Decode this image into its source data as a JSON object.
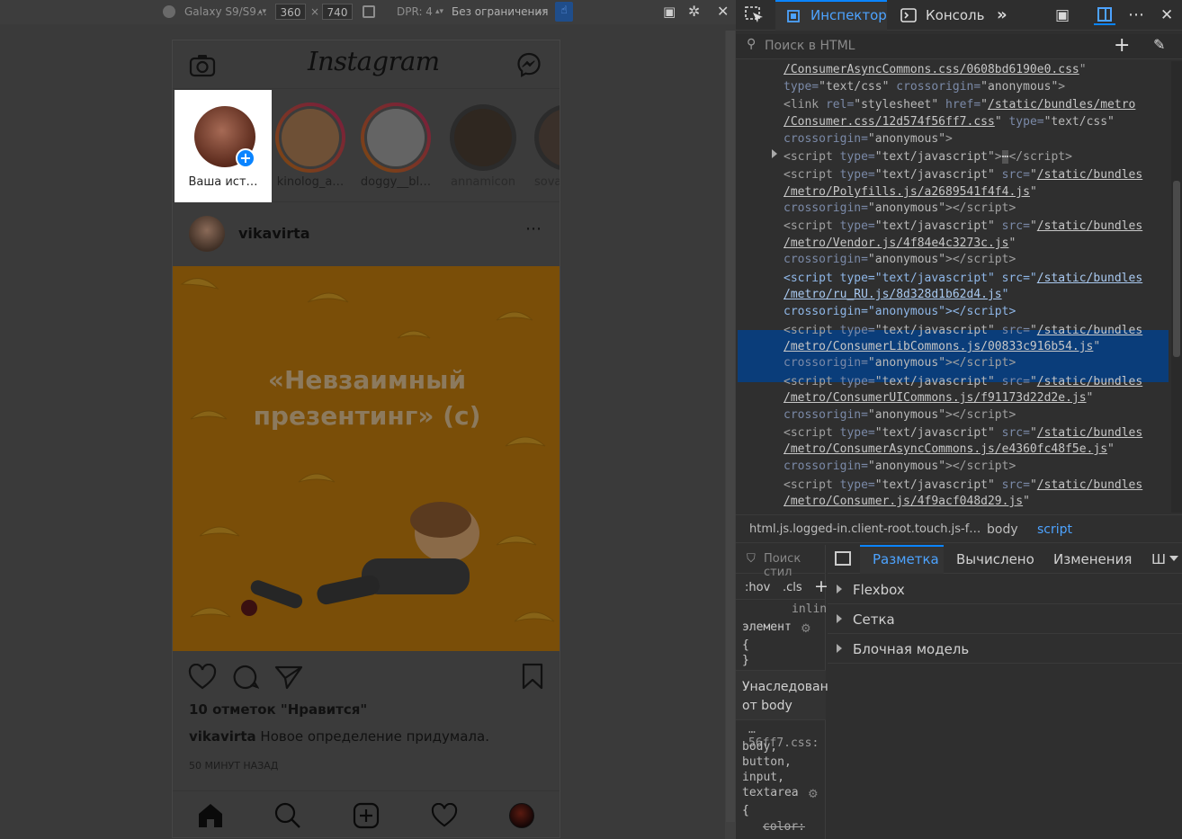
{
  "rdm": {
    "device": "Galaxy S9/S9…",
    "width": "360",
    "times": "×",
    "height": "740",
    "dpr": "DPR: 4",
    "throttle": "Без ограничения"
  },
  "instagram": {
    "logo": "Instagram",
    "stories": [
      {
        "name": "Ваша ист…",
        "own": true,
        "color": "#7a4431"
      },
      {
        "name": "kinolog_a…",
        "own": false,
        "color": "#b88a5a"
      },
      {
        "name": "doggy__bl…",
        "own": false,
        "color": "#a8a8a8"
      },
      {
        "name": "annamicon",
        "own": false,
        "color": "#504030"
      },
      {
        "name": "sova",
        "own": false,
        "color": "#605048"
      }
    ],
    "post": {
      "username": "vikavirta",
      "image_text_line1": "«Невзаимный",
      "image_text_line2": "презентинг» (с)",
      "likes": "10 отметок \"Нравится\"",
      "caption_user": "vikavirta",
      "caption_text": "Новое определение придумала.",
      "time": "50 МИНУТ НАЗАД"
    }
  },
  "devtools": {
    "tabs": {
      "inspector": "Инспектор",
      "console": "Консоль"
    },
    "search_placeholder": "Поиск в HTML",
    "breadcrumb": [
      "html.js.logged-in.client-root.touch.js-f…",
      "body",
      "script"
    ],
    "styles_filter": "Поиск стил",
    "hov": ":hov",
    "cls": ".cls",
    "inline": "inlin",
    "element_rule": "элемент",
    "brace_open": "{",
    "brace_close": "}",
    "inherited": "Унаследован от body",
    "source": "…56ff7.css:",
    "selectors": [
      "body,",
      "button,",
      "input,",
      "textarea"
    ],
    "brace_open2": "{",
    "prop": "color:",
    "layout_tabs": [
      "Разметка",
      "Вычислено",
      "Изменения",
      "Ш"
    ],
    "sections": [
      "Flexbox",
      "Сетка",
      "Блочная модель"
    ]
  },
  "colors": {
    "accent": "#0a84ff",
    "selection": "#0a3d7a",
    "orange": "#f2a000"
  }
}
